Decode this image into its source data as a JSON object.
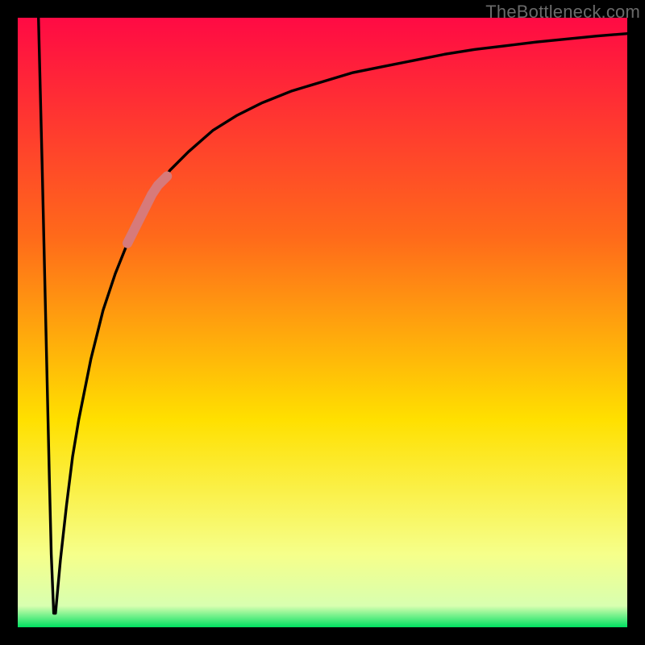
{
  "watermark": "TheBottleneck.com",
  "colors": {
    "frame": "#000000",
    "gradient_top": "#ff0a44",
    "gradient_mid1": "#ff6a1a",
    "gradient_mid2": "#ffe000",
    "gradient_mid3": "#f6ff8a",
    "gradient_bottom": "#00e060",
    "curve": "#000000",
    "highlight": "#d77a7a"
  },
  "chart_data": {
    "type": "line",
    "title": "",
    "xlabel": "",
    "ylabel": "",
    "xlim": [
      0,
      100
    ],
    "ylim": [
      0,
      100
    ],
    "curve": {
      "name": "bottleneck-curve",
      "description": "Single V-shaped curve: near-vertical drop from top-left to a sharp minimum near x≈6, then asymptotic rise toward ~98 at the right edge.",
      "x": [
        3.4,
        3.7,
        4.0,
        4.3,
        4.6,
        4.9,
        5.2,
        5.5,
        5.9,
        6.2,
        7,
        8,
        9,
        10,
        12,
        14,
        16,
        18,
        20,
        22,
        25,
        28,
        32,
        36,
        40,
        45,
        50,
        55,
        60,
        65,
        70,
        75,
        80,
        85,
        90,
        95,
        100
      ],
      "y": [
        100,
        88,
        76,
        63,
        50,
        37,
        24,
        12,
        2.3,
        2.3,
        11,
        20,
        28,
        34,
        44,
        52,
        58,
        63,
        67,
        71,
        75,
        78,
        81.5,
        84,
        86,
        88,
        89.5,
        91,
        92,
        93,
        94,
        94.8,
        95.4,
        96,
        96.5,
        97,
        97.4
      ]
    },
    "highlight_segment": {
      "name": "highlighted-range",
      "description": "Short thick pink segment overlaid on the rising limb between roughly x=18 and x=24.",
      "x": [
        18,
        19,
        20,
        21,
        22,
        23,
        24.5
      ],
      "y": [
        63,
        65,
        67,
        69,
        71,
        72.5,
        74
      ]
    },
    "background_gradient_stops": [
      {
        "offset": 0.0,
        "color": "#ff0a44"
      },
      {
        "offset": 0.36,
        "color": "#ff6a1a"
      },
      {
        "offset": 0.66,
        "color": "#ffe000"
      },
      {
        "offset": 0.88,
        "color": "#f6ff8a"
      },
      {
        "offset": 0.965,
        "color": "#d8ffb0"
      },
      {
        "offset": 1.0,
        "color": "#00e060"
      }
    ]
  }
}
